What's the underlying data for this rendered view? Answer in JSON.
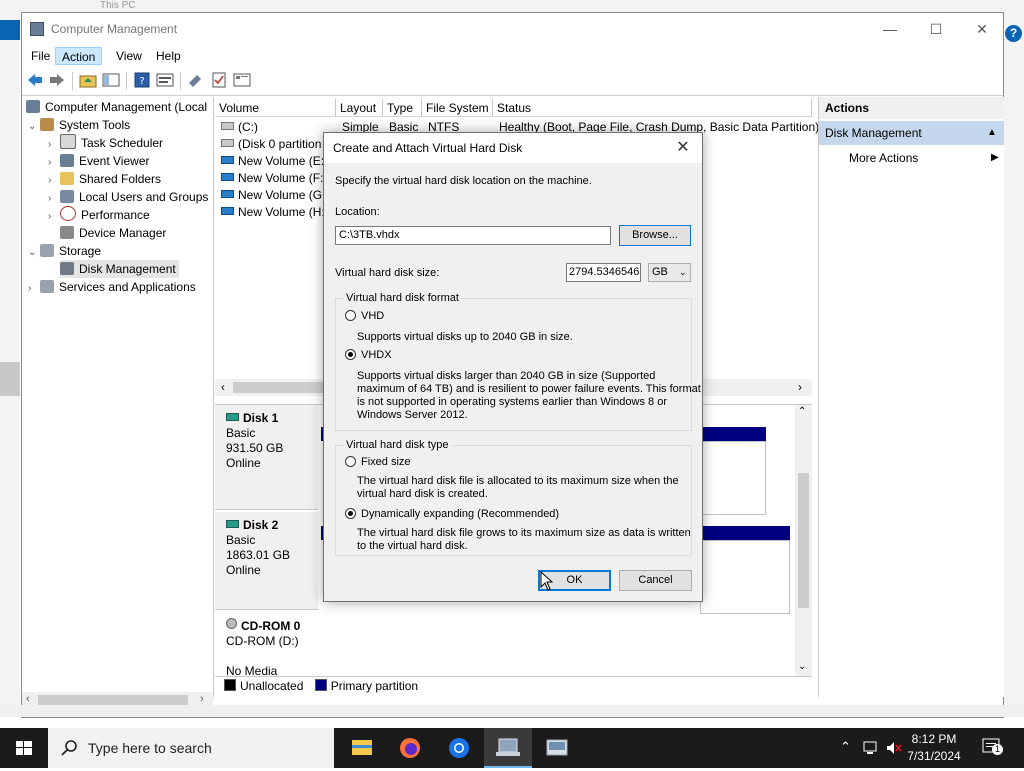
{
  "window": {
    "title": "Computer Management",
    "background_title": "This PC",
    "controls": {
      "minimize": "—",
      "maximize": "☐",
      "close": "✕"
    }
  },
  "menu": [
    "File",
    "Action",
    "View",
    "Help"
  ],
  "tree": {
    "root": "Computer Management (Local",
    "system_tools": "System Tools",
    "task_scheduler": "Task Scheduler",
    "event_viewer": "Event Viewer",
    "shared_folders": "Shared Folders",
    "local_users": "Local Users and Groups",
    "performance": "Performance",
    "device_manager": "Device Manager",
    "storage": "Storage",
    "disk_management": "Disk Management",
    "services": "Services and Applications"
  },
  "volume_list": {
    "columns": [
      "Volume",
      "Layout",
      "Type",
      "File System",
      "Status"
    ],
    "rows": [
      {
        "volume": "(C:)",
        "layout": "Simple",
        "type": "Basic",
        "fs": "NTFS",
        "status": "Healthy (Boot, Page File, Crash Dump, Basic Data Partition)"
      },
      {
        "volume": "(Disk 0 partition",
        "layout": "",
        "type": "",
        "fs": "",
        "status": ""
      },
      {
        "volume": "New Volume (E:)",
        "layout": "",
        "type": "",
        "fs": "",
        "status": ""
      },
      {
        "volume": "New Volume (F:)",
        "layout": "",
        "type": "",
        "fs": "",
        "status": ""
      },
      {
        "volume": "New Volume (G:)",
        "layout": "",
        "type": "",
        "fs": "",
        "status": ""
      },
      {
        "volume": "New Volume (H:)",
        "layout": "",
        "type": "",
        "fs": "",
        "status": ""
      }
    ]
  },
  "disks": [
    {
      "name": "Disk 1",
      "type": "Basic",
      "size": "931.50 GB",
      "state": "Online"
    },
    {
      "name": "Disk 2",
      "type": "Basic",
      "size": "1863.01 GB",
      "state": "Online"
    },
    {
      "name": "CD-ROM 0",
      "type": "CD-ROM (D:)",
      "size": "",
      "state": "No Media"
    }
  ],
  "legend": {
    "unallocated": "Unallocated",
    "primary": "Primary partition"
  },
  "actions": {
    "header": "Actions",
    "section": "Disk Management",
    "more": "More Actions"
  },
  "dialog": {
    "title": "Create and Attach Virtual Hard Disk",
    "instruction": "Specify the virtual hard disk location on the machine.",
    "location_label": "Location:",
    "location_value": "C:\\3TB.vhdx",
    "browse": "Browse...",
    "size_label": "Virtual hard disk size:",
    "size_value": "2794.5346546",
    "size_unit": "GB",
    "format_group": "Virtual hard disk format",
    "vhd_label": "VHD",
    "vhd_desc": "Supports virtual disks up to 2040 GB in size.",
    "vhdx_label": "VHDX",
    "vhdx_desc_1": "Supports virtual disks larger than 2040 GB in size (Supported",
    "vhdx_desc_2": "maximum of 64 TB) and is resilient to power failure events. This format",
    "vhdx_desc_3": "is not supported in operating systems earlier than Windows 8 or",
    "vhdx_desc_4": "Windows Server 2012.",
    "type_group": "Virtual hard disk type",
    "fixed_label": "Fixed size",
    "fixed_desc_1": "The virtual hard disk file is allocated to its maximum size when the",
    "fixed_desc_2": "virtual hard disk is created.",
    "dynamic_label": "Dynamically expanding (Recommended)",
    "dynamic_desc_1": "The virtual hard disk file grows to its maximum size as data is written",
    "dynamic_desc_2": "to the virtual hard disk.",
    "ok": "OK",
    "cancel": "Cancel",
    "selected_format": "VHDX",
    "selected_type": "Dynamically expanding"
  },
  "taskbar": {
    "search_placeholder": "Type here to search",
    "time": "8:12 PM",
    "date": "7/31/2024",
    "notification_count": "1"
  },
  "colors": {
    "accent": "#0078d7",
    "partition": "#000080",
    "taskbar": "#1b1b1b"
  }
}
